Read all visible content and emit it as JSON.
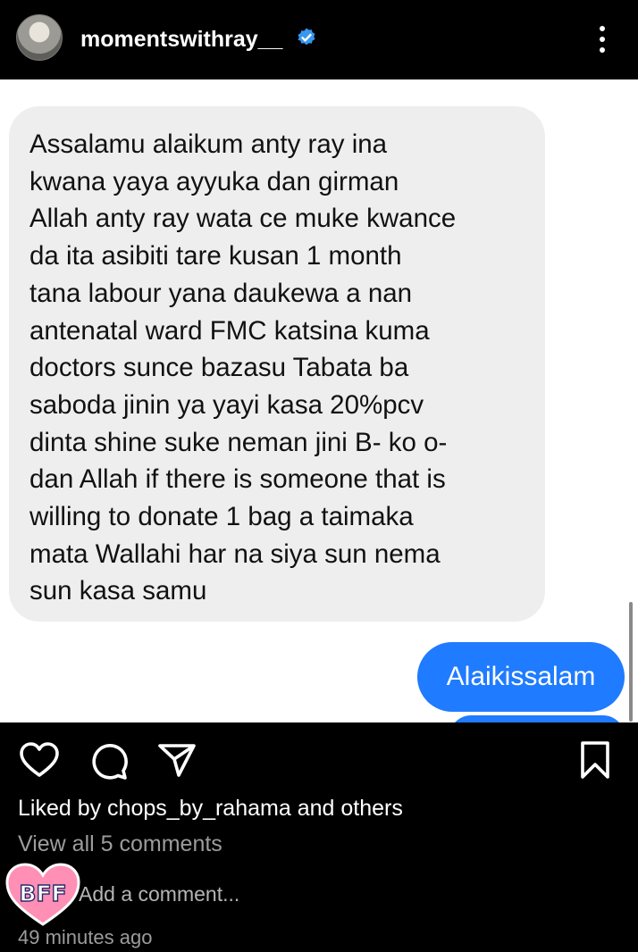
{
  "header": {
    "username": "momentswithray__",
    "verified_icon": "verified-badge-icon",
    "menu_icon": "more-vertical-icon"
  },
  "screenshot": {
    "incoming_lines": [
      "Assalamu alaikum anty ray ina",
      "kwana yaya ayyuka dan girman",
      "Allah anty ray wata ce muke kwance",
      "da ita asibiti tare kusan 1 month",
      "tana labour yana daukewa a nan",
      "antenatal ward FMC katsina kuma",
      "doctors sunce bazasu Tabata ba",
      "saboda jinin ya yayi kasa 20%pcv",
      "dinta shine suke neman jini B- ko o-",
      "dan Allah if there is someone that is",
      "willing to donate 1 bag a taimaka",
      "mata Wallahi har na siya sun nema",
      "sun kasa samu"
    ],
    "reply": "Alaikissalam",
    "incoming_color": "#eeeeee",
    "outgoing_color": "#1f7bff"
  },
  "actions": {
    "like_icon": "heart-icon",
    "comment_icon": "comment-icon",
    "share_icon": "send-icon",
    "save_icon": "bookmark-icon"
  },
  "footer": {
    "likes": "Liked by chops_by_rahama and others",
    "view_comments": "View all 5 comments",
    "add_comment": "Add a comment...",
    "time_ago": "49 minutes ago",
    "sticker_text": "BFF"
  }
}
